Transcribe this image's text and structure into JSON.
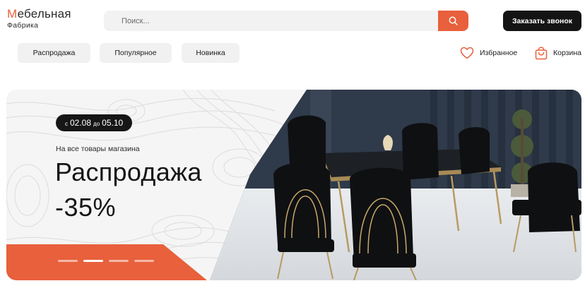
{
  "logo": {
    "first_letter": "М",
    "rest": "ебельная",
    "subtitle": "Фабрика"
  },
  "search": {
    "placeholder": "Поиск...",
    "icon": "search-icon"
  },
  "header": {
    "call_button": "Заказать звонок"
  },
  "nav": {
    "items": [
      {
        "label": "Распродажа"
      },
      {
        "label": "Популярное"
      },
      {
        "label": "Новинка"
      }
    ]
  },
  "aux": {
    "favorites": "Избранное",
    "cart": "Корзина"
  },
  "hero": {
    "date_from_prefix": "с",
    "date_from": "02.08",
    "date_to_prefix": "до",
    "date_to": "05.10",
    "subtitle": "На все товары магазина",
    "title": "Распродажа",
    "discount": "-35%",
    "slides_count": 4,
    "active_slide": 2
  },
  "colors": {
    "accent": "#e8603c",
    "dark": "#141414",
    "pill_bg": "#f1f1f1"
  }
}
